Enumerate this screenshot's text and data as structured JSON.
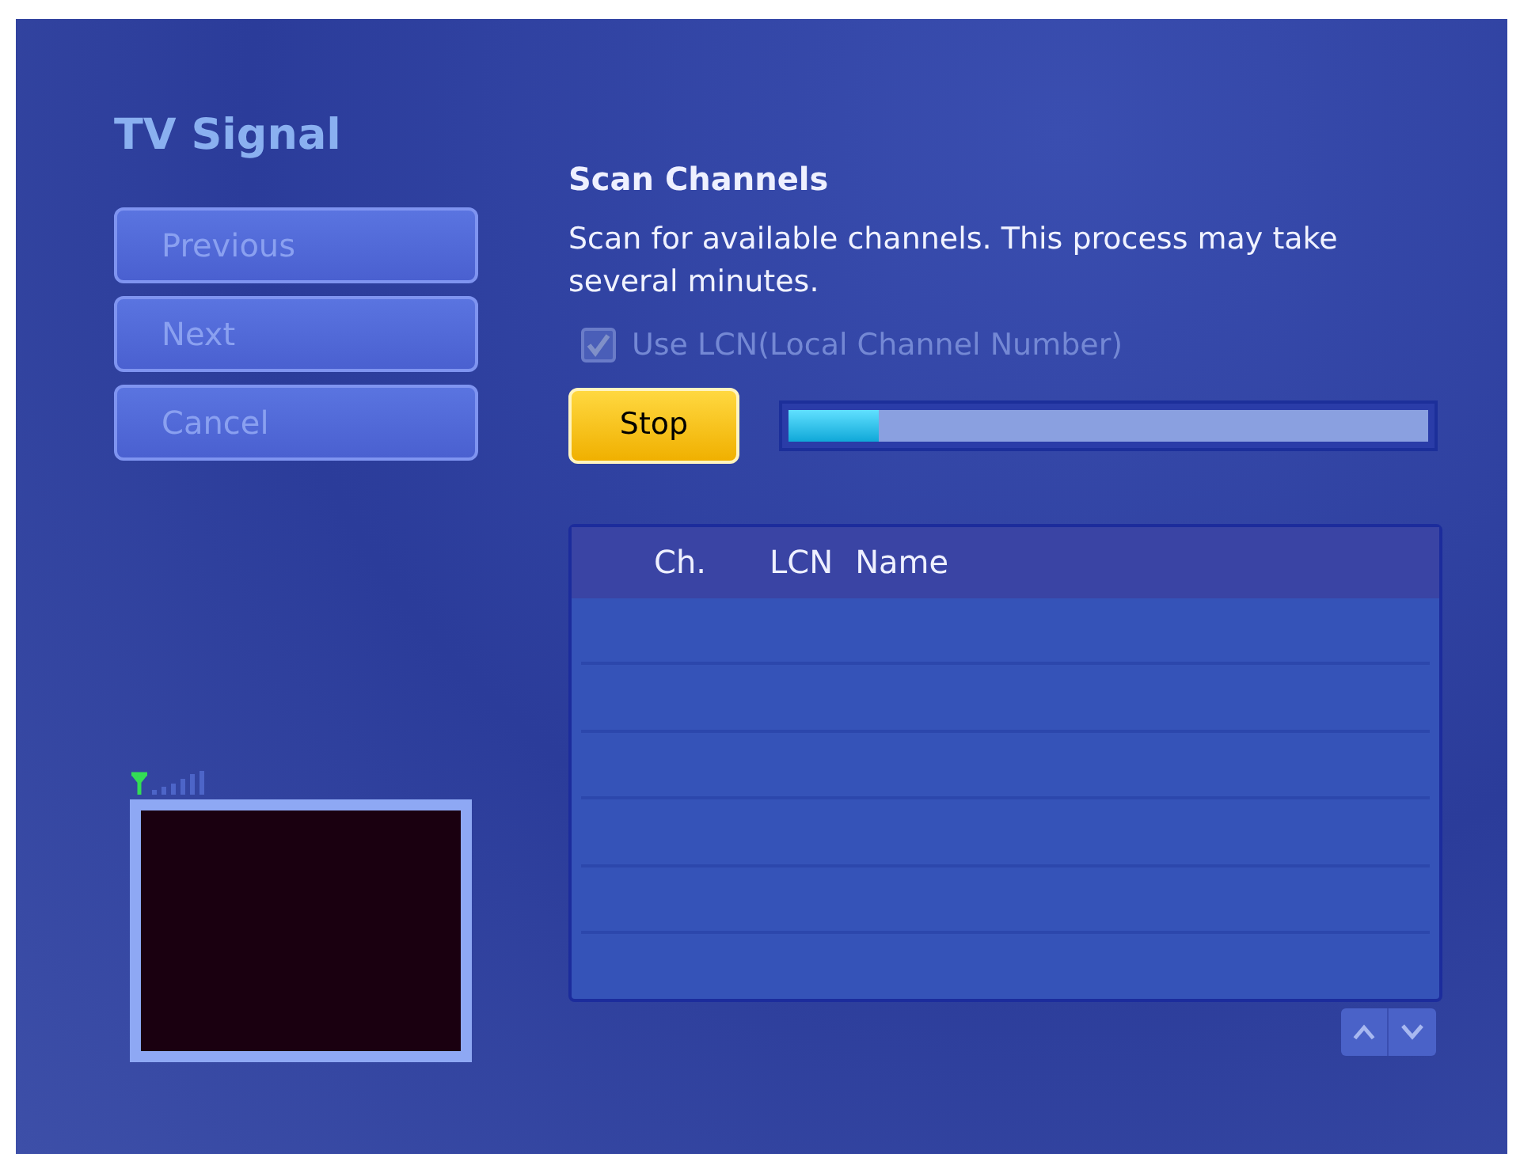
{
  "title": "TV Signal",
  "nav_buttons": [
    {
      "label": "Previous",
      "disabled": true
    },
    {
      "label": "Next",
      "disabled": true
    },
    {
      "label": "Cancel",
      "disabled": true
    }
  ],
  "heading": "Scan Channels",
  "description": "Scan for available channels. This process may take several minutes.",
  "lcn_checkbox": {
    "label": "Use LCN(Local Channel Number)",
    "checked": true,
    "disabled": true
  },
  "stop_button": {
    "label": "Stop"
  },
  "scan_progress": {
    "level": 0.14
  },
  "channel_table": {
    "columns": [
      "Ch.",
      "LCN",
      "Name"
    ]
  }
}
